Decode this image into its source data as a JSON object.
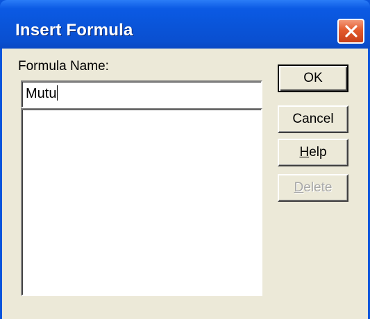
{
  "window": {
    "title": "Insert Formula",
    "close_icon": "close-icon"
  },
  "form": {
    "formula_name_label": "Formula Name:",
    "formula_name_value": "Mutu",
    "formula_list_items": []
  },
  "buttons": {
    "ok_label": "OK",
    "cancel_label": "Cancel",
    "help_label_accel": "H",
    "help_label_rest": "elp",
    "delete_label_accel": "D",
    "delete_label_rest": "elete",
    "delete_disabled": true
  },
  "colors": {
    "titlebar": "#0a54d8",
    "client": "#ece9d8",
    "close_button": "#e35a2c"
  }
}
